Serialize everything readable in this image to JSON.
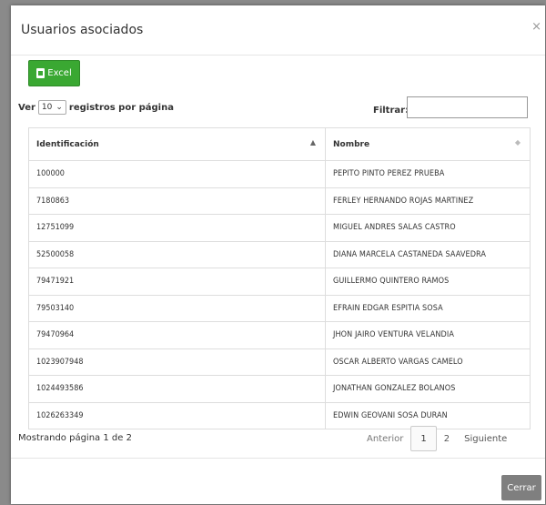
{
  "modal": {
    "title": "Usuarios asociados",
    "close_symbol": "×"
  },
  "toolbar": {
    "excel_label": "Excel",
    "excel_icon": "file-excel-icon",
    "accent_color": "#3aa832"
  },
  "length_menu": {
    "prefix": "Ver",
    "selected": "10",
    "suffix": "registros por página"
  },
  "filter": {
    "label": "Filtrar:",
    "value": ""
  },
  "table": {
    "headers": [
      "Identificación",
      "Nombre"
    ],
    "rows": [
      [
        "100000",
        "PEPITO PINTO PEREZ PRUEBA"
      ],
      [
        "7180863",
        "FERLEY HERNANDO ROJAS MARTINEZ"
      ],
      [
        "12751099",
        "MIGUEL ANDRES SALAS CASTRO"
      ],
      [
        "52500058",
        "DIANA MARCELA CASTANEDA SAAVEDRA"
      ],
      [
        "79471921",
        "GUILLERMO QUINTERO RAMOS"
      ],
      [
        "79503140",
        "EFRAIN EDGAR ESPITIA SOSA"
      ],
      [
        "79470964",
        "JHON JAIRO VENTURA VELANDIA"
      ],
      [
        "1023907948",
        "OSCAR ALBERTO VARGAS CAMELO"
      ],
      [
        "1024493586",
        "JONATHAN GONZALEZ BOLANOS"
      ],
      [
        "1026263349",
        "EDWIN GEOVANI SOSA DURAN"
      ]
    ]
  },
  "info": "Mostrando página 1 de 2",
  "pagination": {
    "previous": "Anterior",
    "pages": [
      "1",
      "2"
    ],
    "current": "1",
    "next": "Siguiente"
  },
  "footer": {
    "close_label": "Cerrar"
  }
}
